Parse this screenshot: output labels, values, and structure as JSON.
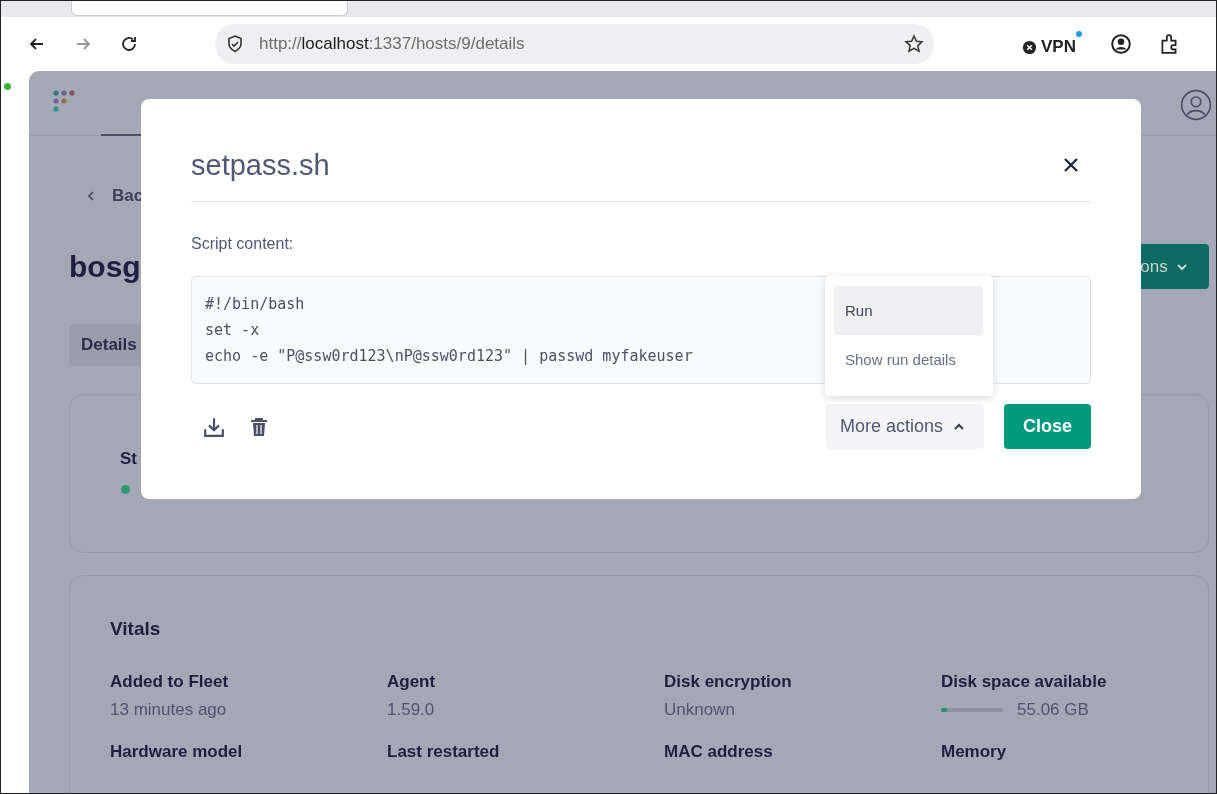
{
  "browser": {
    "url_scheme": "http://",
    "url_host": "localhost",
    "url_rest": ":1337/hosts/9/details",
    "vpn_label": "VPN"
  },
  "page": {
    "back_link": "Bac",
    "host_name": "bosg",
    "actions_button": "ons",
    "tabs": [
      {
        "label": "Details",
        "selected": true
      }
    ],
    "status": {
      "label": "St",
      "color": "#2f9a74"
    },
    "vitals": {
      "title": "Vitals",
      "items": [
        {
          "label": "Added to Fleet",
          "value": "13 minutes ago",
          "kind": "text"
        },
        {
          "label": "Agent",
          "value": "1.59.0",
          "kind": "text"
        },
        {
          "label": "Disk encryption",
          "value": "Unknown",
          "kind": "text"
        },
        {
          "label": "Disk space available",
          "value": "55.06 GB",
          "kind": "meter",
          "level": 0.1
        },
        {
          "label": "Hardware model",
          "kind": "label"
        },
        {
          "label": "Last restarted",
          "kind": "label"
        },
        {
          "label": "MAC address",
          "kind": "label"
        },
        {
          "label": "Memory",
          "kind": "label"
        }
      ]
    }
  },
  "modal": {
    "title": "setpass.sh",
    "content_label": "Script content:",
    "script_lines": [
      "#!/bin/bash",
      "set -x",
      "echo -e \"P@ssw0rd123\\nP@ssw0rd123\" | passwd myfakeuser"
    ],
    "menu": [
      {
        "label": "Run",
        "selected": true
      },
      {
        "label": "Show run details",
        "selected": false
      }
    ],
    "more_actions": "More actions",
    "close_button": "Close"
  }
}
